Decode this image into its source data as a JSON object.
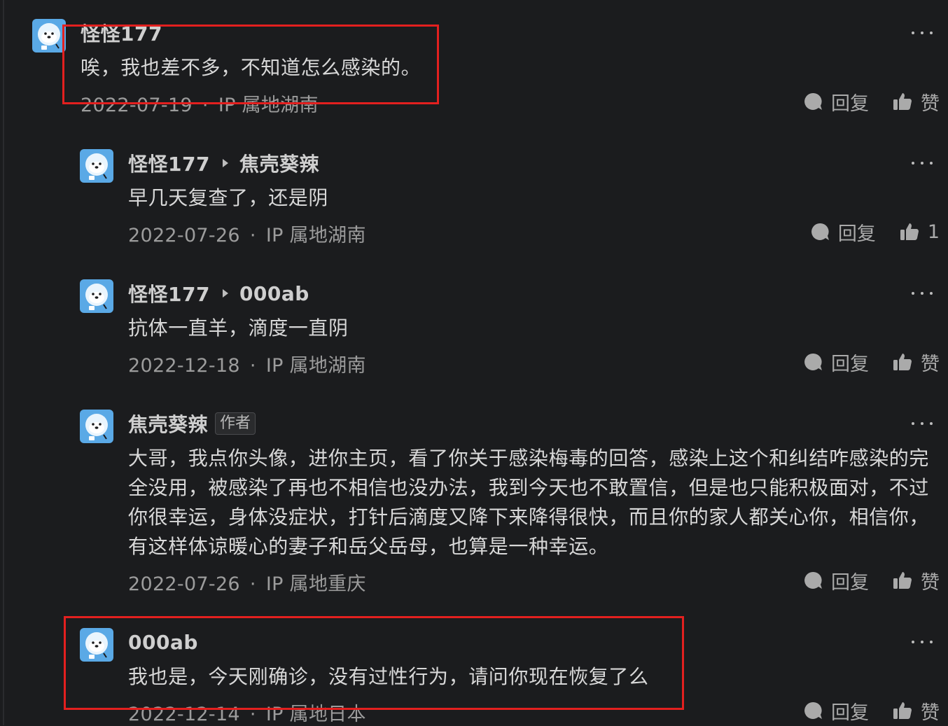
{
  "comments": [
    {
      "author": "怪怪177",
      "reply_to": "",
      "badge": "",
      "content": "唉，我也差不多，不知道怎么感染的。",
      "date": "2022-07-19",
      "location": "IP 属地湖南",
      "reply_label": "回复",
      "like_label": "赞"
    },
    {
      "author": "怪怪177",
      "reply_to": "焦壳葵辣",
      "badge": "",
      "content": "早几天复查了，还是阴",
      "date": "2022-07-26",
      "location": "IP 属地湖南",
      "reply_label": "回复",
      "like_label": "1"
    },
    {
      "author": "怪怪177",
      "reply_to": "000ab",
      "badge": "",
      "content": "抗体一直羊，滴度一直阴",
      "date": "2022-12-18",
      "location": "IP 属地湖南",
      "reply_label": "回复",
      "like_label": "赞"
    },
    {
      "author": "焦壳葵辣",
      "reply_to": "",
      "badge": "作者",
      "content": "大哥，我点你头像，进你主页，看了你关于感染梅毒的回答，感染上这个和纠结咋感染的完全没用，被感染了再也不相信也没办法，我到今天也不敢置信，但是也只能积极面对，不过你很幸运，身体没症状，打针后滴度又降下来降得很快，而且你的家人都关心你，相信你，有这样体谅暖心的妻子和岳父岳母，也算是一种幸运。",
      "date": "2022-07-26",
      "location": "IP 属地重庆",
      "reply_label": "回复",
      "like_label": "赞"
    },
    {
      "author": "000ab",
      "reply_to": "",
      "badge": "",
      "content": "我也是，今天刚确诊，没有过性行为，请问你现在恢复了么",
      "date": "2022-12-14",
      "location": "IP 属地日本",
      "reply_label": "回复",
      "like_label": "赞"
    }
  ],
  "meta_separator": "·",
  "colors": {
    "background": "#1b1c1e",
    "highlight": "#e3201f",
    "avatar": "#5aa9e6"
  },
  "icons": [
    "avatar-bear-icon",
    "reply-arrow-icon",
    "more-icon",
    "comment-bubble-icon",
    "thumbs-up-icon"
  ]
}
